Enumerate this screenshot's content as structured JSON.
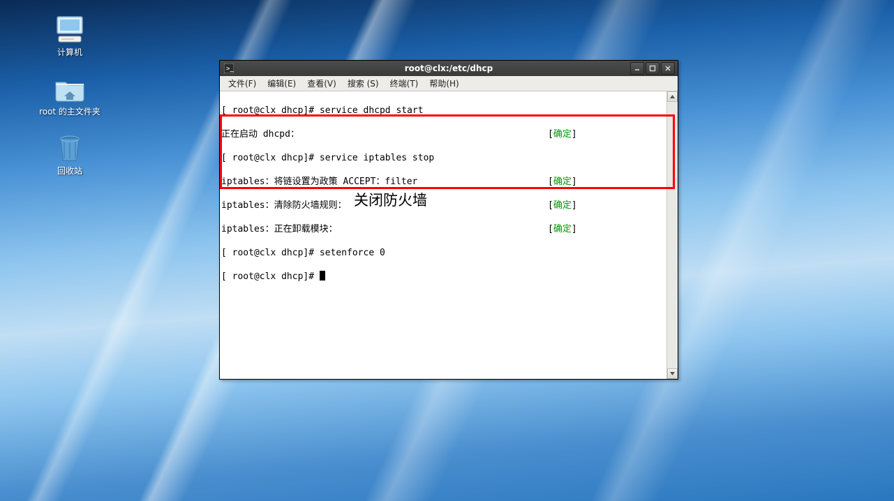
{
  "desktop_icons": {
    "computer": "计算机",
    "home": "root 的主文件夹",
    "trash": "回收站"
  },
  "window": {
    "title": "root@clx:/etc/dhcp",
    "menu": {
      "file": "文件(F)",
      "edit": "编辑(E)",
      "view": "查看(V)",
      "search": "搜索 (S)",
      "terminal": "终端(T)",
      "help": "帮助(H)"
    }
  },
  "terminal": {
    "line1": "[ root@clx dhcp]# service dhcpd start",
    "line2l": "正在启动 dhcpd：",
    "line2r": "[确定]",
    "line3": "[ root@clx dhcp]# service iptables stop",
    "line4l": "iptables：将链设置为政策 ACCEPT：filter",
    "line4r": "[确定]",
    "line5l": "iptables：清除防火墙规则：",
    "line5r": "[确定]",
    "line6l": "iptables：正在卸载模块：",
    "line6r": "[确定]",
    "line7": "[ root@clx dhcp]# setenforce 0",
    "line8": "[ root@clx dhcp]# "
  },
  "status_ok": "确定",
  "annotation": "关闭防火墙"
}
